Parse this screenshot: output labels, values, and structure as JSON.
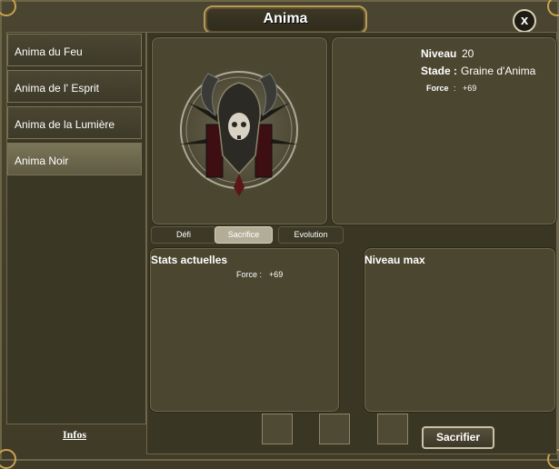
{
  "window": {
    "title": "Anima",
    "close_label": "x"
  },
  "sidebar": {
    "items": [
      {
        "label": "Anima du Feu"
      },
      {
        "label": "Anima de l' Esprit"
      },
      {
        "label": "Anima de la Lumière"
      },
      {
        "label": "Anima Noir"
      }
    ],
    "active_index": 3,
    "infos_label": "Infos"
  },
  "info": {
    "niveau_label": "Niveau",
    "niveau_value": "20",
    "stade_label": "Stade :",
    "stade_value": "Graine d'Anima",
    "force_label": "Force",
    "force_sep": ":",
    "force_value": "+69"
  },
  "subtabs": [
    {
      "label": "Défi"
    },
    {
      "label": "Sacrifice"
    },
    {
      "label": "Evolution"
    }
  ],
  "active_subtab": 1,
  "stats": {
    "title": "Stats actuelles",
    "force_label": "Force :",
    "force_value": "+69"
  },
  "max_level": {
    "title": "Niveau max"
  },
  "actions": {
    "sacrifice_button": "Sacrifier"
  },
  "colors": {
    "gold": "#c9a24f",
    "panel": "#4a4630",
    "accent_tab": "#b3ad98"
  }
}
